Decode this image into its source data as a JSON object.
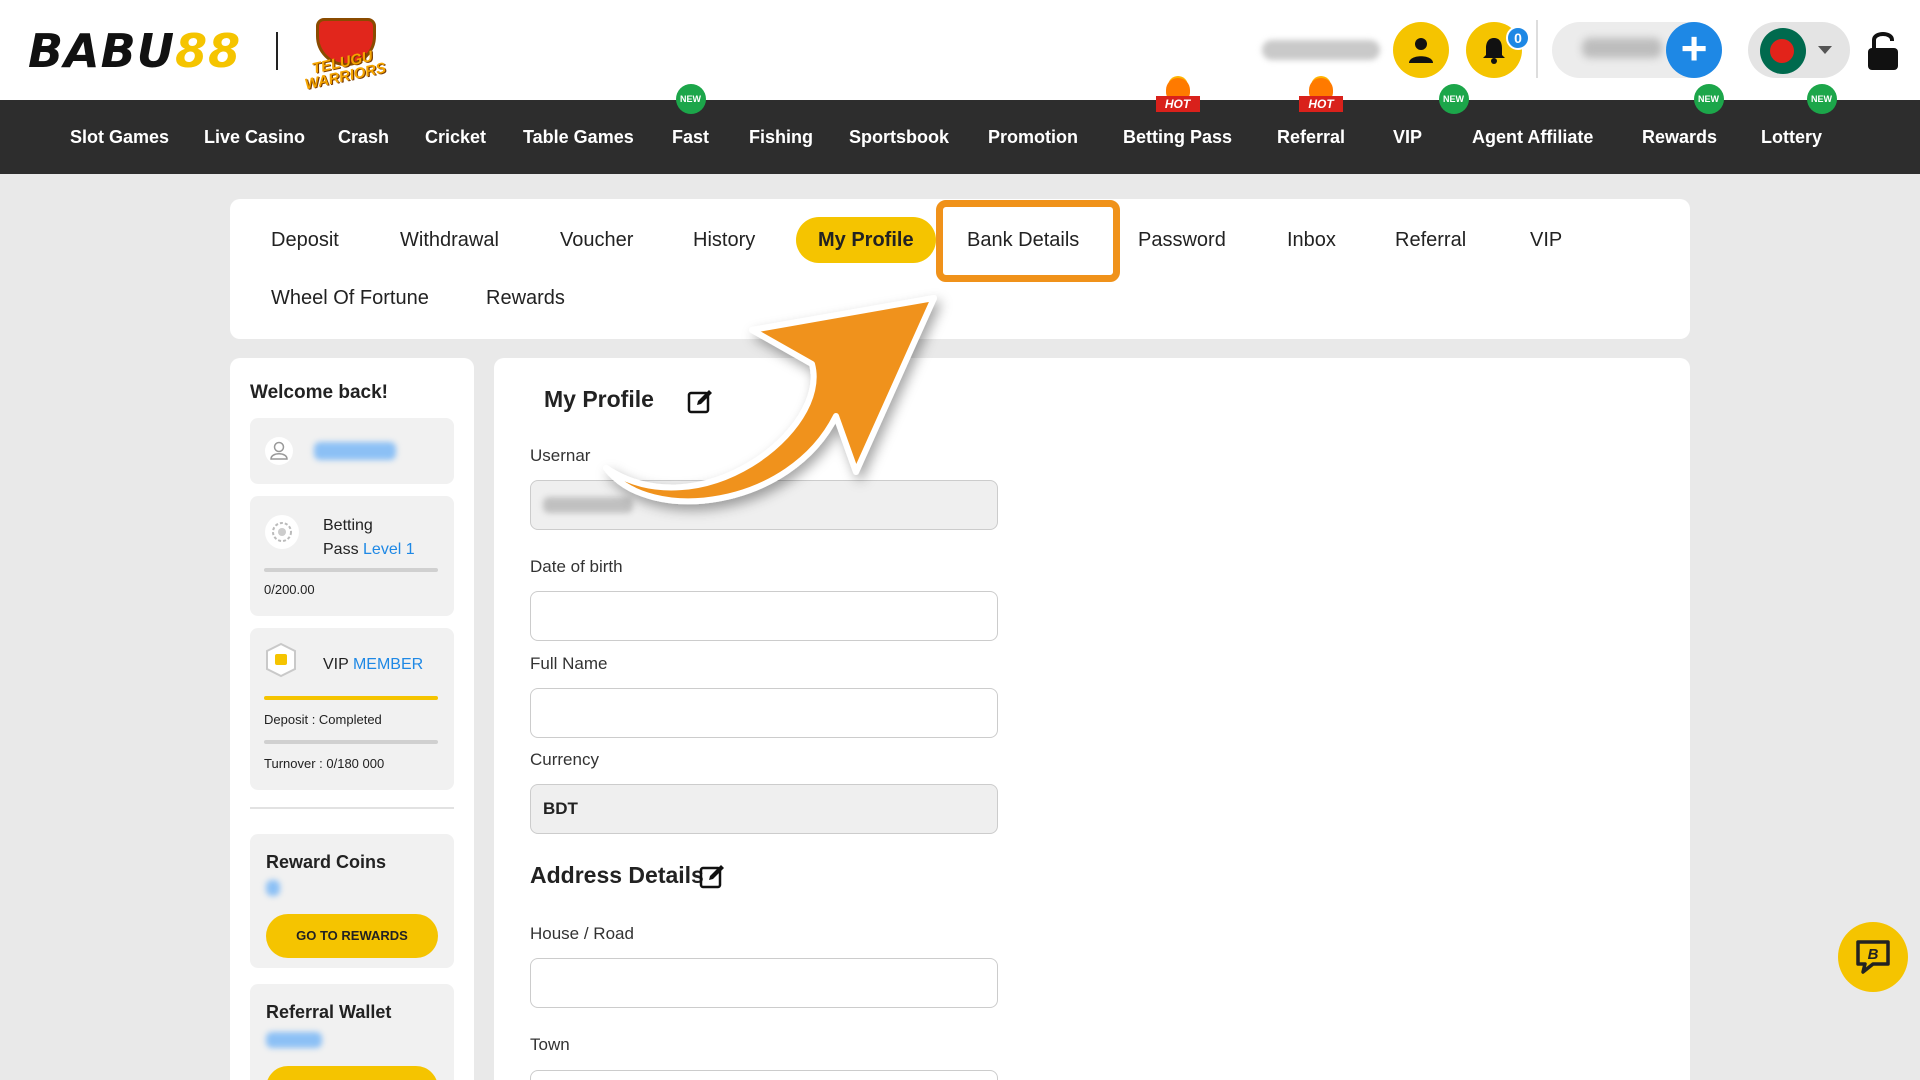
{
  "brand": {
    "logo_text_a": "BABU",
    "logo_text_b": "88",
    "partner_logo_text": "TELUGU WARRIORS"
  },
  "header": {
    "notification_count": "0"
  },
  "nav": {
    "items": [
      {
        "label": "Slot Games",
        "badge": ""
      },
      {
        "label": "Live Casino",
        "badge": ""
      },
      {
        "label": "Crash",
        "badge": ""
      },
      {
        "label": "Cricket",
        "badge": ""
      },
      {
        "label": "Table Games",
        "badge": ""
      },
      {
        "label": "Fast",
        "badge": "NEW"
      },
      {
        "label": "Fishing",
        "badge": ""
      },
      {
        "label": "Sportsbook",
        "badge": ""
      },
      {
        "label": "Promotion",
        "badge": ""
      },
      {
        "label": "Betting Pass",
        "badge": "HOT"
      },
      {
        "label": "Referral",
        "badge": "HOT"
      },
      {
        "label": "VIP",
        "badge": "NEW"
      },
      {
        "label": "Agent Affiliate",
        "badge": ""
      },
      {
        "label": "Rewards",
        "badge": "NEW"
      },
      {
        "label": "Lottery",
        "badge": "NEW"
      }
    ]
  },
  "tabs": [
    {
      "label": "Deposit",
      "active": false
    },
    {
      "label": "Withdrawal",
      "active": false
    },
    {
      "label": "Voucher",
      "active": false
    },
    {
      "label": "History",
      "active": false
    },
    {
      "label": "My Profile",
      "active": true
    },
    {
      "label": "Bank Details",
      "active": false
    },
    {
      "label": "Password",
      "active": false
    },
    {
      "label": "Inbox",
      "active": false
    },
    {
      "label": "Referral",
      "active": false
    },
    {
      "label": "VIP",
      "active": false
    },
    {
      "label": "Wheel Of Fortune",
      "active": false
    },
    {
      "label": "Rewards",
      "active": false
    }
  ],
  "sidebar": {
    "welcome": "Welcome back!",
    "betting_pass": {
      "title_line1": "Betting",
      "title_line2": "Pass",
      "level": "Level 1",
      "progress_text": "0/200.00",
      "progress": 0.0
    },
    "vip": {
      "label": "VIP",
      "tier": "MEMBER",
      "deposit_text": "Deposit : Completed",
      "deposit_progress": 1.0,
      "turnover_text": "Turnover : 0/180 000",
      "turnover_progress": 0.0
    },
    "reward_coins": {
      "title": "Reward Coins",
      "button": "GO TO REWARDS"
    },
    "referral_wallet": {
      "title": "Referral Wallet"
    }
  },
  "profile": {
    "title": "My Profile",
    "username_label": "Usernar",
    "dob_label": "Date of birth",
    "dob_value": "",
    "fullname_label": "Full Name",
    "fullname_value": "",
    "currency_label": "Currency",
    "currency_value": "BDT",
    "address_title": "Address Details",
    "house_label": "House / Road",
    "house_value": "",
    "town_label": "Town"
  },
  "colors": {
    "accent": "#f5c400",
    "nav_bg": "#2d2d2d",
    "highlight": "#f0921a",
    "link_blue": "#1e88e5",
    "new_badge": "#1ca64a",
    "hot_badge": "#d9211b"
  }
}
